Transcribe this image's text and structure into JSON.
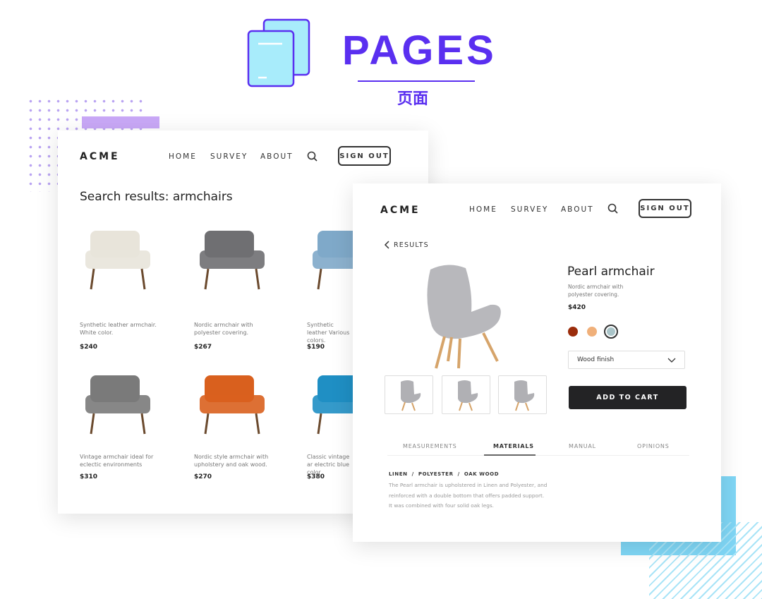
{
  "header": {
    "title": "PAGES",
    "subtitle": "页面",
    "icon": "pages-icon"
  },
  "colors": {
    "accent": "#5a2ff0",
    "deco_purple": "#c9a8f7",
    "deco_blue": "#7fd6f5"
  },
  "results_page": {
    "logo": "ACME",
    "nav": [
      "HOME",
      "SURVEY",
      "ABOUT"
    ],
    "sign_out": "SIGN OUT",
    "heading": "Search results: armchairs",
    "products": [
      {
        "desc": "Synthetic leather armchair. White color.",
        "price": "$240",
        "color": "#e8e4da"
      },
      {
        "desc": "Nordic armchair with polyester covering.",
        "price": "$267",
        "color": "#6f6f72"
      },
      {
        "desc": "Synthetic leather Various colors.",
        "price": "$190",
        "color": "#7fa9c9"
      },
      {
        "desc": "Vintage armchair ideal for eclectic environments",
        "price": "$310",
        "color": "#7a7a7a"
      },
      {
        "desc": "Nordic style armchair with upholstery and oak wood.",
        "price": "$270",
        "color": "#d9601e"
      },
      {
        "desc": "Classic vintage ar electric blue color",
        "price": "$380",
        "color": "#1f8fc4"
      }
    ]
  },
  "detail_page": {
    "logo": "ACME",
    "nav": [
      "HOME",
      "SURVEY",
      "ABOUT"
    ],
    "sign_out": "SIGN OUT",
    "back": "RESULTS",
    "name": "Pearl armchair",
    "desc": "Nordic armchair with polyester covering.",
    "price": "$420",
    "swatches": [
      "#9b2d0c",
      "#f0b07a",
      "#a9c4c8"
    ],
    "selected_swatch": 2,
    "finish": "Wood finish",
    "add_to_cart": "ADD TO CART",
    "tabs": [
      "MEASUREMENTS",
      "MATERIALS",
      "MANUAL",
      "OPINIONS"
    ],
    "active_tab": "MATERIALS",
    "materials": "LINEN  /  POLYESTER  /  OAK WOOD",
    "materials_text": "The Pearl armchair is upholstered in Linen and Polyester, and reinforced with a double bottom that offers padded support. It was combined with four solid oak legs."
  }
}
